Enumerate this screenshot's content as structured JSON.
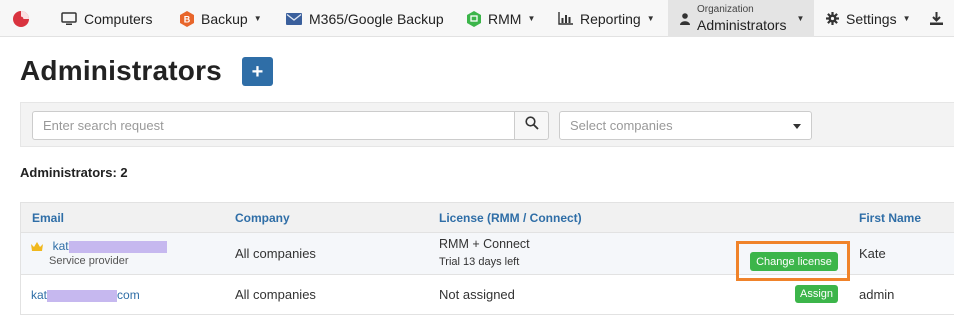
{
  "nav": {
    "computers": "Computers",
    "backup": "Backup",
    "m365": "M365/Google Backup",
    "rmm": "RMM",
    "reporting": "Reporting",
    "org_small": "Organization",
    "org_big": "Administrators",
    "settings": "Settings"
  },
  "page": {
    "title": "Administrators",
    "add_label": "+"
  },
  "filters": {
    "search_placeholder": "Enter search request",
    "company_placeholder": "Select companies"
  },
  "count_label": "Administrators: 2",
  "table": {
    "headers": {
      "email": "Email",
      "company": "Company",
      "license": "License (RMM / Connect)",
      "first_name": "First Name"
    },
    "rows": [
      {
        "email_prefix": "kat",
        "email_suffix": "",
        "role": "Service provider",
        "company": "All companies",
        "license": "RMM + Connect",
        "license_sub": "Trial 13 days left",
        "action": "Change license",
        "first_name": "Kate"
      },
      {
        "email_prefix": "kat",
        "email_suffix": "com",
        "role": "",
        "company": "All companies",
        "license": "Not assigned",
        "license_sub": "",
        "action": "Assign",
        "first_name": "admin"
      }
    ]
  },
  "colors": {
    "accent": "#2f6ea7",
    "success": "#3cb54a",
    "highlight": "#f0832a",
    "logo": "#d9333f"
  }
}
